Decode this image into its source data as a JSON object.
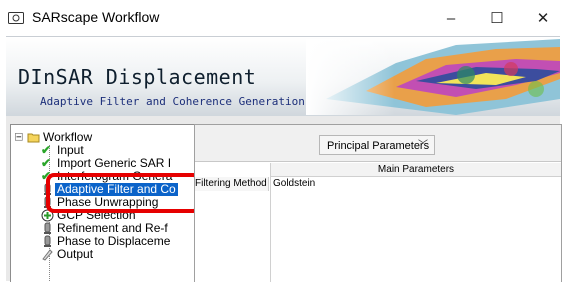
{
  "window": {
    "title": "SARscape Workflow",
    "icon": "app-icon"
  },
  "controls": {
    "minimize": "–",
    "maximize": "☐",
    "close": "✕"
  },
  "header": {
    "title": "DInSAR Displacement",
    "subtitle": "Adaptive Filter and Coherence Generation"
  },
  "tree": {
    "root": "Workflow",
    "items": [
      {
        "label": "Input",
        "status": "done"
      },
      {
        "label": "Import Generic SAR I",
        "status": "done"
      },
      {
        "label": "Interferogram Genera",
        "status": "done"
      },
      {
        "label": "Adaptive Filter and Co",
        "status": "current",
        "selected": true
      },
      {
        "label": "Phase Unwrapping",
        "status": "pending"
      },
      {
        "label": "GCP Selection",
        "status": "add"
      },
      {
        "label": "Refinement and Re-f",
        "status": "pending"
      },
      {
        "label": "Phase to Displaceme",
        "status": "pending"
      },
      {
        "label": "Output",
        "status": "pending"
      }
    ]
  },
  "params": {
    "selector": "Principal Parameters",
    "table_header": "Main Parameters",
    "rows": [
      {
        "key": "Filtering Method",
        "value": "Goldstein"
      }
    ]
  },
  "colors": {
    "accent": "#0b63c9",
    "highlight": "#e60000"
  }
}
